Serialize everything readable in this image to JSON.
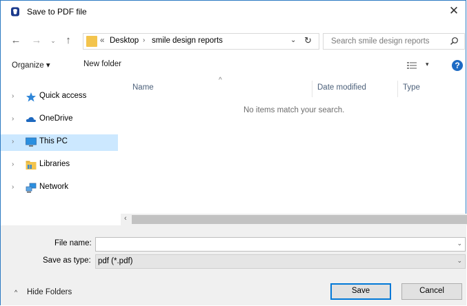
{
  "window": {
    "title": "Save to PDF file",
    "close_glyph": "✕"
  },
  "address": {
    "back_glyph": "←",
    "forward_glyph": "→",
    "recent_glyph": "⌄",
    "up_glyph": "↑",
    "overflow": "«",
    "crumbs": [
      "Desktop",
      "smile design reports"
    ],
    "crumb_sep": "›",
    "dropdown_glyph": "⌄",
    "refresh_glyph": "↻"
  },
  "search": {
    "placeholder": "Search smile design reports"
  },
  "toolbar": {
    "organize_label": "Organize ▾",
    "new_folder_label": "New folder",
    "view_caret": "▾",
    "help_glyph": "?"
  },
  "nav": {
    "chevron": "›",
    "items": [
      {
        "label": "Quick access",
        "icon": "star-icon"
      },
      {
        "label": "OneDrive",
        "icon": "cloud-icon"
      },
      {
        "label": "This PC",
        "icon": "monitor-icon",
        "selected": true
      },
      {
        "label": "Libraries",
        "icon": "library-folder-icon"
      },
      {
        "label": "Network",
        "icon": "network-icon"
      }
    ]
  },
  "content": {
    "sort_glyph": "^",
    "columns": [
      "Name",
      "Date modified",
      "Type"
    ],
    "empty_message": "No items match your search.",
    "scroll_left": "‹"
  },
  "form": {
    "file_name_label": "File name:",
    "file_name_value": "",
    "save_type_label": "Save as type:",
    "save_type_value": "pdf (*.pdf)",
    "caret": "⌄"
  },
  "footer": {
    "hide_folders_label": "Hide Folders",
    "hide_caret": "^",
    "save_label": "Save",
    "cancel_label": "Cancel"
  },
  "colors": {
    "accent": "#0078d7",
    "selection": "#cce8ff",
    "folder": "#f3c44d"
  }
}
